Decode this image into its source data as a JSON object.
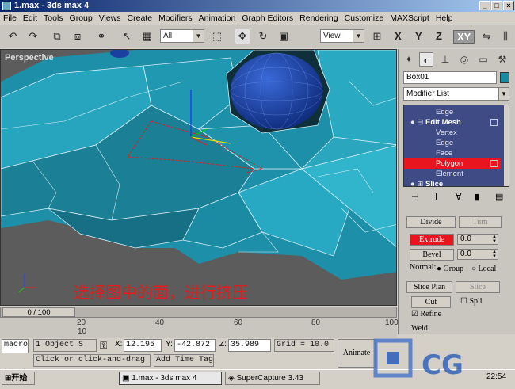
{
  "window": {
    "title": "1.max - 3ds max 4",
    "min": "_",
    "max": "□",
    "close": "×"
  },
  "menu": [
    "File",
    "Edit",
    "Tools",
    "Group",
    "Views",
    "Create",
    "Modifiers",
    "Animation",
    "Graph Editors",
    "Rendering",
    "Customize",
    "MAXScript",
    "Help"
  ],
  "toolbar": {
    "selection_filter": "All",
    "coord_system": "View",
    "axes": [
      "X",
      "Y",
      "Z",
      "XY"
    ],
    "active_axis": "XY"
  },
  "viewport": {
    "label": "Perspective",
    "caption": "选择图中的面，进行挤压"
  },
  "command_panel": {
    "object_name": "Box01",
    "object_color": "#1a8aa0",
    "modifier_list": "Modifier List",
    "stack": [
      {
        "label": "Edge",
        "indent": 2,
        "highlighted": false
      },
      {
        "label": "Edit Mesh",
        "indent": 1,
        "highlighted": false,
        "bold": true
      },
      {
        "label": "Vertex",
        "indent": 2,
        "highlighted": false
      },
      {
        "label": "Edge",
        "indent": 2,
        "highlighted": false
      },
      {
        "label": "Face",
        "indent": 2,
        "highlighted": false
      },
      {
        "label": "Polygon",
        "indent": 2,
        "highlighted": true
      },
      {
        "label": "Element",
        "indent": 2,
        "highlighted": false
      },
      {
        "label": "Slice",
        "indent": 1,
        "highlighted": false,
        "bold": true
      }
    ],
    "divide_label": "Divide",
    "turn_label": "Turn",
    "extrude_label": "Extrude",
    "extrude_value": "0.0",
    "bevel_label": "Bevel",
    "bevel_value": "0.0",
    "normal_label": "Normal:",
    "group_label": "Group",
    "local_label": "Local",
    "slice_plane_label": "Slice Plan",
    "slice_label": "Slice",
    "cut_label": "Cut",
    "split_label": "Spli",
    "refine_label": "Refine",
    "weld_label": "Weld"
  },
  "timeline": {
    "frame": "0 / 100",
    "ticks": [
      "10",
      "20",
      "40",
      "60",
      "80",
      "100"
    ]
  },
  "status": {
    "macro": "macro",
    "selection": "1 Object S",
    "x_label": "X:",
    "x": "12.195",
    "y_label": "Y:",
    "y": "-42.872",
    "z_label": "Z:",
    "z": "35.989",
    "grid": "Grid = 10.0",
    "animate": "Animate",
    "prompt": "Click or click-and-drag to",
    "add_time_tag": "Add Time Tag"
  },
  "taskbar": {
    "start": "开始",
    "tasks": [
      "1.max - 3ds max 4",
      "SuperCapture 3.43"
    ],
    "clock": "22:54"
  },
  "watermark": "CG"
}
